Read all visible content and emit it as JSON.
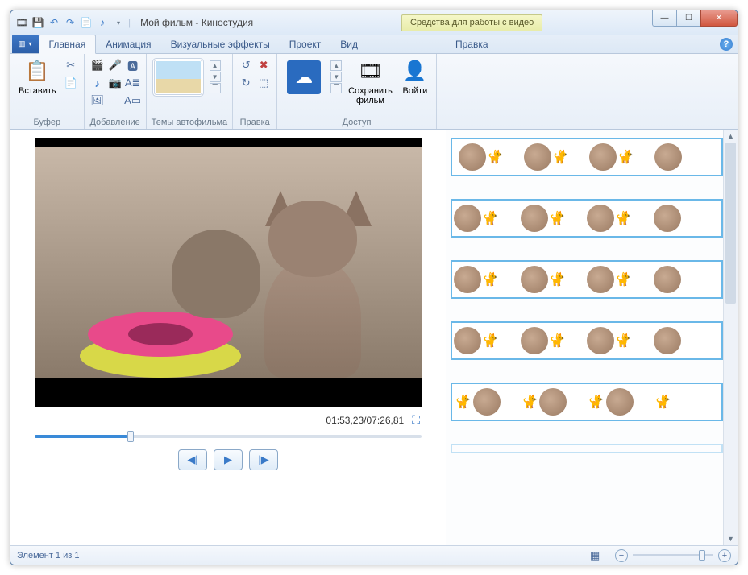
{
  "title": "Мой фильм - Киностудия",
  "context_tab_label": "Средства для работы с видео",
  "tabs": {
    "home": "Главная",
    "animation": "Анимация",
    "visual_effects": "Визуальные эффекты",
    "project": "Проект",
    "view": "Вид",
    "edit": "Правка"
  },
  "ribbon": {
    "paste": "Вставить",
    "buffer": "Буфер",
    "adding": "Добавление",
    "themes": "Темы автофильма",
    "editing": "Правка",
    "save_movie": "Сохранить\nфильм",
    "login": "Войти",
    "access": "Доступ"
  },
  "preview": {
    "time": "01:53,23/07:26,81"
  },
  "status": {
    "item_count": "Элемент 1 из 1"
  },
  "icons": {
    "app": "🎞",
    "save": "💾",
    "undo": "↶",
    "redo": "↷",
    "music_dd": "♪",
    "qat_dd": "▾",
    "help": "?",
    "clipboard": "📋",
    "cut": "✂",
    "copy": "📄",
    "video": "🎬",
    "photo": "🖼",
    "music": "♪",
    "mic": "🎤",
    "cam": "📷",
    "title": "🅰",
    "caption": "A≣",
    "credits": "A▭",
    "rot_l": "↺",
    "rot_r": "↻",
    "crop": "▦",
    "sel": "⬚",
    "cloud": "☁",
    "film": "🎞",
    "user": "👤",
    "fullscreen": "⛶",
    "prev": "◀|",
    "play": "▶",
    "next": "|▶",
    "thumbs": "▦",
    "minus": "−",
    "plus": "+",
    "min": "—",
    "max": "☐",
    "close": "✕",
    "up": "▲",
    "down": "▼",
    "menu": "▔"
  }
}
